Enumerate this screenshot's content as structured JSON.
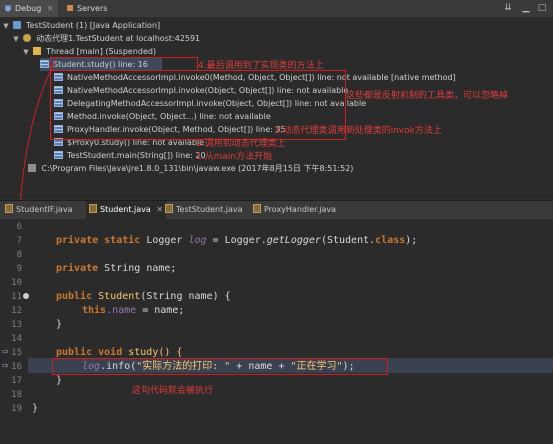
{
  "top_tabs": {
    "debug": "Debug",
    "servers": "Servers"
  },
  "debug_tree": {
    "root": "TestStudent (1) [Java Application]",
    "vm": "动态代理1.TestStudent at localhost:42591",
    "thread": "Thread [main] (Suspended)",
    "frames": [
      "Student.study() line: 16",
      "NativeMethodAccessorImpl.invoke0(Method, Object, Object[]) line: not available [native method]",
      "NativeMethodAccessorImpl.invoke(Object, Object[]) line: not available",
      "DelegatingMethodAccessorImpl.invoke(Object, Object[]) line: not available",
      "Method.invoke(Object, Object...) line: not available",
      "ProxyHandler.invoke(Object, Method, Object[]) line: 35",
      "$Proxy0.study() line: not available",
      "TestStudent.main(String[]) line: 20"
    ],
    "process": "C:\\Program Files\\Java\\jre1.8.0_131\\bin\\javaw.exe (2017年8月15日 下午8:51:52)"
  },
  "annotations": {
    "a4": "4.最后调用到了实现类的方法上",
    "a_reflect": "这些都是反射机制的工具类，可以忽略掉",
    "a3": "3.动态代理类调用到处理类的invok方法上",
    "a2": "2.调用到动态代理类上",
    "a1": "1.从main方法开始",
    "a_exec": "这句代码就会被执行"
  },
  "editor_tabs": [
    {
      "label": "StudentIF.java"
    },
    {
      "label": "Student.java",
      "close": "✕"
    },
    {
      "label": "TestStudent.java"
    },
    {
      "label": "ProxyHandler.java"
    }
  ],
  "line_numbers": [
    "6",
    "7",
    "8",
    "9",
    "10",
    "11",
    "12",
    "13",
    "14",
    "15",
    "16",
    "17",
    "18",
    "19"
  ],
  "code": {
    "l7_kw": "private static ",
    "l7_type": "Logger ",
    "l7_log": "log",
    "l7_eq": " = ",
    "l7_cls": "Logger",
    "l7_dot": ".",
    "l7_method": "getLogger",
    "l7_open": "(",
    "l7_arg": "Student",
    "l7_dot2": ".",
    "l7_classkw": "class",
    "l7_close": ");",
    "l9_kw": "private ",
    "l9_type": "String ",
    "l9_name": "name;",
    "l11_kw": "public ",
    "l11_cls": "Student",
    "l11_open": "(",
    "l11_ptype": "String ",
    "l11_pname": "name) {",
    "l12_kw": "this",
    "l12_field": ".name",
    "l12_rest": " = name;",
    "l13": "}",
    "l15_kw": "public void ",
    "l15_name": "study() {",
    "l16_log": "log",
    "l16_info": ".info(",
    "l16_str1": "\"实际方法的打印: \"",
    "l16_plus": " + name + ",
    "l16_str2": "\"正在学习\"",
    "l16_end": ");",
    "l17": "}",
    "l19": "}"
  }
}
